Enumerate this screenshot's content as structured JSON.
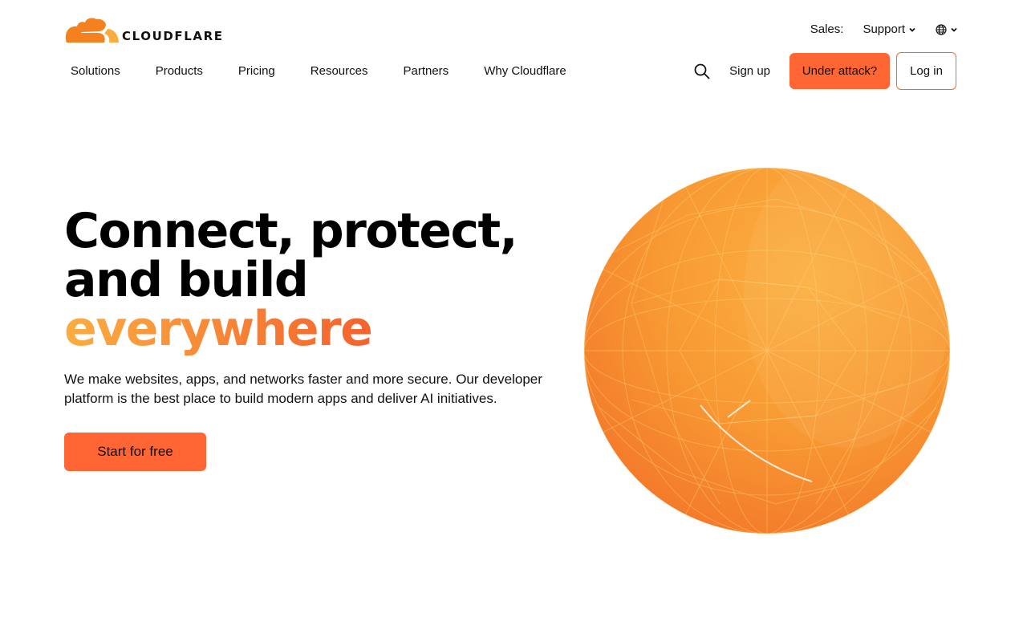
{
  "brand": {
    "name": "CLOUDFLARE",
    "logo_icon": "cloud-logo-icon",
    "accent_color": "#ff6633",
    "logo_orange": "#f48120",
    "logo_yellow": "#faad3f"
  },
  "utility": {
    "sales_label": "Sales:",
    "support_label": "Support",
    "language_icon": "globe-icon"
  },
  "nav": {
    "items": [
      {
        "label": "Solutions"
      },
      {
        "label": "Products"
      },
      {
        "label": "Pricing"
      },
      {
        "label": "Resources"
      },
      {
        "label": "Partners"
      },
      {
        "label": "Why Cloudflare"
      }
    ],
    "search_icon": "search-icon",
    "signup_label": "Sign up",
    "under_attack_label": "Under attack?",
    "login_label": "Log in"
  },
  "hero": {
    "title_line1": "Connect, protect,",
    "title_line2": "and build",
    "title_accent": "everywhere",
    "description": "We make websites, apps, and networks faster and more secure. Our developer platform is the best place to build modern apps and deliver AI initiatives.",
    "cta_label": "Start for free",
    "illustration": "globe-illustration"
  }
}
